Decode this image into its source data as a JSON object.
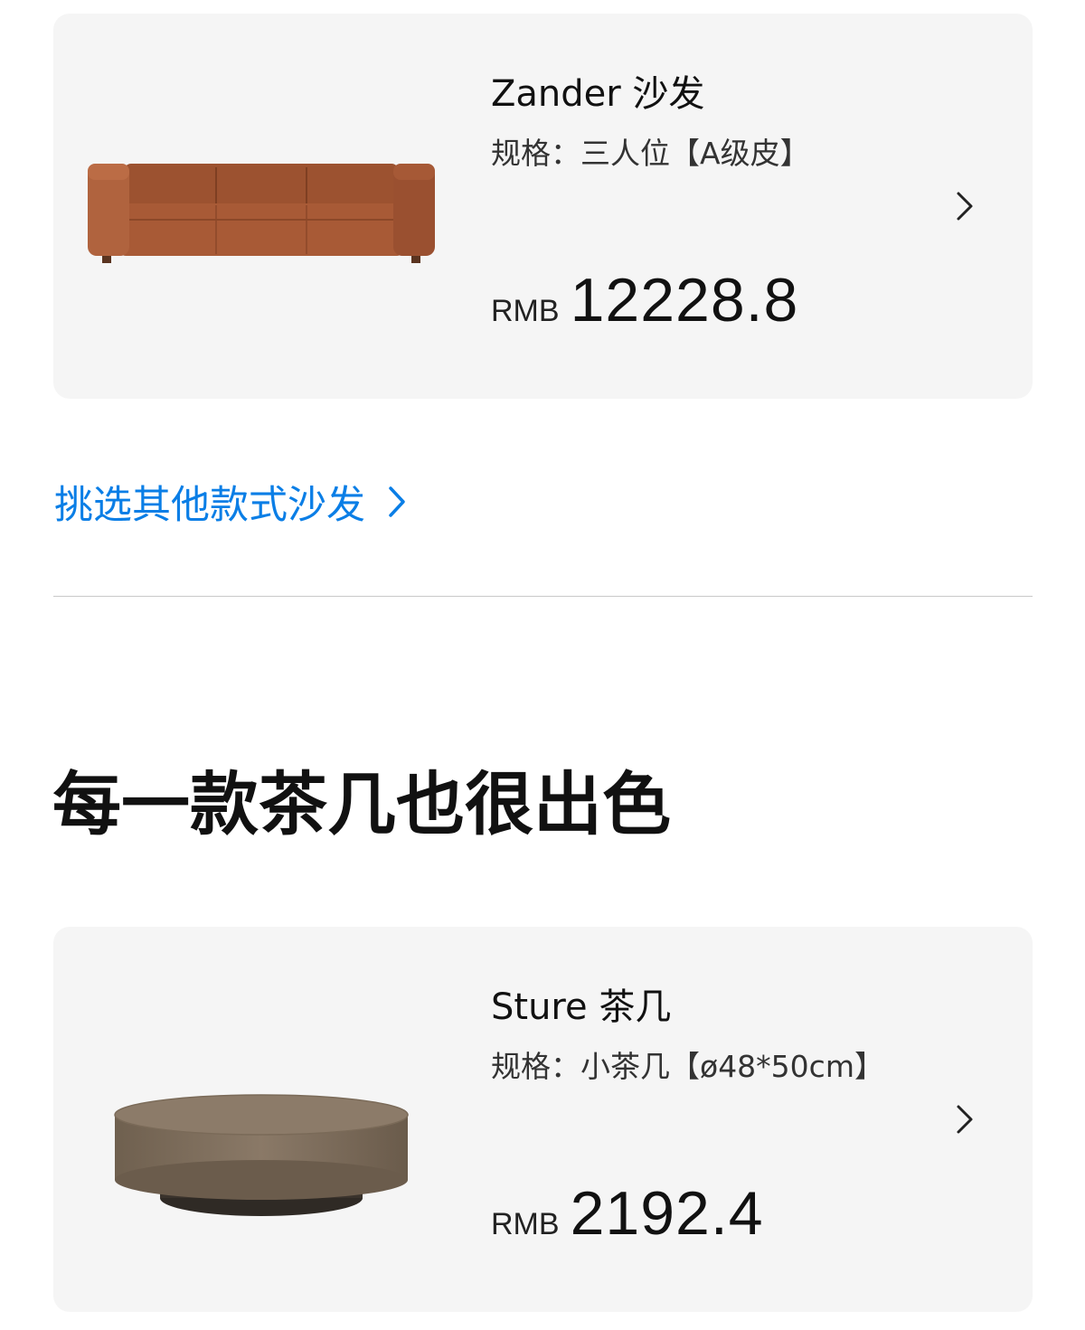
{
  "sofa_card": {
    "name": "Zander 沙发",
    "spec": "规格：三人位【A级皮】",
    "currency": "RMB",
    "price": "12228.8",
    "image_icon": "leather-sofa-image",
    "chevron_icon": "chevron-right-icon"
  },
  "browse_link": {
    "label": "挑选其他款式沙发",
    "icon": "chevron-right-icon"
  },
  "section": {
    "title": "每一款茶几也很出色"
  },
  "table_card": {
    "name": "Sture 茶几",
    "spec": "规格：小茶几【ø48*50cm】",
    "currency": "RMB",
    "price": "2192.4",
    "image_icon": "round-coffee-table-image",
    "chevron_icon": "chevron-right-icon"
  },
  "colors": {
    "card_background": "#f5f5f5",
    "link_blue": "#0a7ee6",
    "divider": "#c9c9c9",
    "sofa_leather": "#a85a36",
    "table_bronze": "#7a6a58"
  }
}
